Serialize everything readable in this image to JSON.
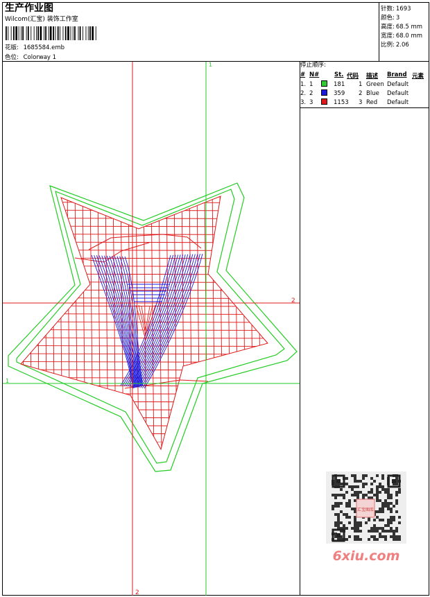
{
  "header": {
    "title": "生产作业图",
    "company": "Wilcom(汇宝) 装饰工作室",
    "design_label": "花版:",
    "design_value": "1685584.emb",
    "colorway_label": "色位:",
    "colorway_value": "Colorway 1"
  },
  "stats": [
    {
      "label": "针数:",
      "value": "1693"
    },
    {
      "label": "颜色:",
      "value": "3"
    },
    {
      "label": "高度:",
      "value": "68.5 mm"
    },
    {
      "label": "宽度:",
      "value": "68.0 mm"
    },
    {
      "label": "比例:",
      "value": "2.06"
    }
  ],
  "stop_sequence": {
    "title": "停止顺序:",
    "headers": [
      "#",
      "N#",
      "St.",
      "代码",
      "描述",
      "Brand",
      "元素"
    ],
    "rows": [
      {
        "index": "1.",
        "needle": "1",
        "color": "#2ecc2e",
        "stitches": "181",
        "code": "1",
        "description": "Green",
        "brand": "Default"
      },
      {
        "index": "2.",
        "needle": "2",
        "color": "#1a1adf",
        "stitches": "359",
        "code": "2",
        "description": "Blue",
        "brand": "Default"
      },
      {
        "index": "3.",
        "needle": "3",
        "color": "#e01818",
        "stitches": "1153",
        "code": "3",
        "description": "Red",
        "brand": "Default"
      }
    ]
  },
  "markers": {
    "green_v": "1",
    "green_h": "1",
    "red_h": "2",
    "red_v": "2"
  },
  "watermark": {
    "stamp_text": "汇宝图库",
    "site": "6xiu.com"
  },
  "colors": {
    "green": "#22cc22",
    "blue": "#1a1adf",
    "red": "#e01818"
  }
}
